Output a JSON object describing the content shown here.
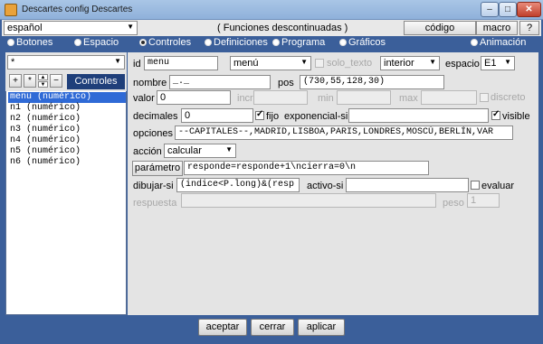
{
  "window": {
    "title": "Descartes config Descartes",
    "min": "–",
    "max": "□",
    "close": "✕"
  },
  "toolbar": {
    "language": "español",
    "notice": "( Funciones  descontinuadas )",
    "code_button": "código",
    "macro_button": "macro",
    "help_button": "?"
  },
  "sections": {
    "botones": "Botones",
    "espacio": "Espacio",
    "controles": "Controles",
    "definiciones": "Definiciones",
    "programa": "Programa",
    "graficos": "Gráficos",
    "animacion": "Animación"
  },
  "left": {
    "filter": "*",
    "add": "+",
    "star": "*",
    "up": "▲",
    "down": "▼",
    "remove": "−",
    "panel_label": "Controles",
    "items": [
      "menu (numérico)",
      "n1 (numérico)",
      "n2 (numérico)",
      "n3 (numérico)",
      "n4 (numérico)",
      "n5 (numérico)",
      "n6 (numérico)"
    ]
  },
  "form": {
    "id_label": "id",
    "id_value": "menu",
    "type_value": "menú",
    "solo_texto_label": "solo_texto",
    "region_value": "interior",
    "espacio_label": "espacio",
    "espacio_value": "E1",
    "nombre_label": "nombre",
    "nombre_value": "_._",
    "pos_label": "pos",
    "pos_value": "(730,55,128,30)",
    "valor_label": "valor",
    "valor_value": "0",
    "incr_label": "incr",
    "min_label": "min",
    "max_label": "max",
    "discreto_label": "discreto",
    "decimales_label": "decimales",
    "decimales_value": "0",
    "fijo_label": "fijo",
    "exponencial_label": "exponencial-si",
    "visible_label": "visible",
    "opciones_label": "opciones",
    "opciones_value": "--CAPITALES--,MADRID,LISBOA,PARIS,LONDRES,MOSCÚ,BERLÍN,VAR",
    "accion_label": "acción",
    "accion_value": "calcular",
    "parametro_button": "parámetro",
    "parametro_value": "responde=responde+1\\ncierra=0\\n",
    "dibujar_label": "dibujar-si",
    "dibujar_value": "(indice<P.long)&(resp",
    "activo_label": "activo-si",
    "evaluar_label": "evaluar",
    "respuesta_label": "respuesta",
    "peso_label": "peso",
    "peso_value": "1"
  },
  "bottom": {
    "accept": "aceptar",
    "close": "cerrar",
    "apply": "aplicar"
  }
}
